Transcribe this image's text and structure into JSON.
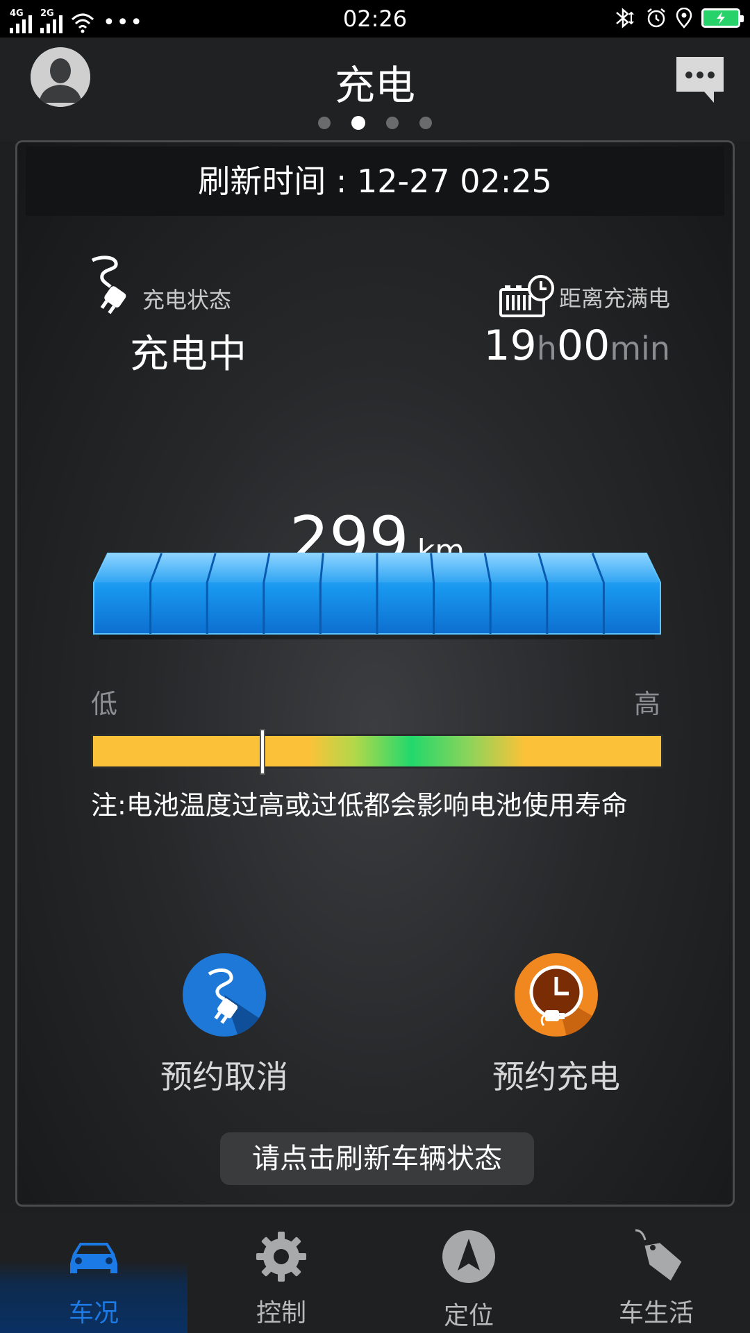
{
  "status_bar": {
    "network_1": "4G",
    "network_2": "2G",
    "more": "•••",
    "time": "02:26"
  },
  "header": {
    "title": "充电",
    "page_count": 4,
    "active_page": 2
  },
  "card": {
    "refresh_time": "刷新时间 : 12-27 02:25",
    "charge_status_label": "充电状态",
    "charge_status_value": "充电中",
    "time_to_full_label": "距离充满电",
    "time_hours": "19",
    "time_hours_unit": "h",
    "time_minutes": "00",
    "time_minutes_unit": "min",
    "range_value": "299",
    "range_unit": "km",
    "battery_segments": 10,
    "temp_low_label": "低",
    "temp_high_label": "高",
    "temp_level": 0.3,
    "note": "注:电池温度过高或过低都会影响电池使用寿命",
    "action_cancel": "预约取消",
    "action_schedule": "预约充电",
    "refresh_button": "请点击刷新车辆状态"
  },
  "tabs": [
    {
      "label": "车况",
      "icon": "car-icon",
      "active": true
    },
    {
      "label": "控制",
      "icon": "gear-icon",
      "active": false
    },
    {
      "label": "定位",
      "icon": "navigation-arrow-icon",
      "active": false
    },
    {
      "label": "车生活",
      "icon": "tag-icon",
      "active": false
    }
  ],
  "colors": {
    "accent_blue": "#1c7ae6",
    "battery_blue": "#1a8ee6",
    "schedule_orange": "#f0871f",
    "temp_yellow": "#fbc239",
    "temp_green": "#22d86c"
  }
}
